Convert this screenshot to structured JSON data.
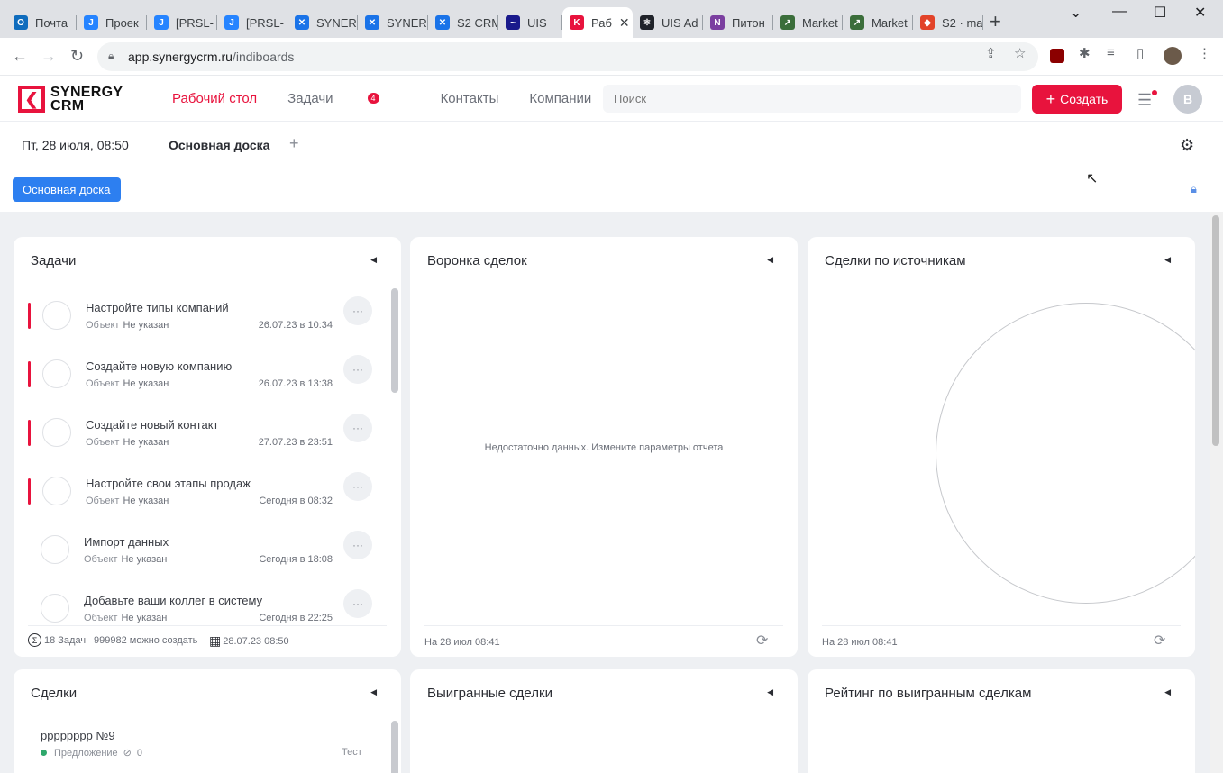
{
  "browser": {
    "tabs": [
      {
        "label": "Почта",
        "color": "#0f6cbd",
        "glyph": "O"
      },
      {
        "label": "Проек",
        "color": "#2684ff",
        "glyph": "J"
      },
      {
        "label": "[PRSL-",
        "color": "#2684ff",
        "glyph": "J"
      },
      {
        "label": "[PRSL-",
        "color": "#2684ff",
        "glyph": "J"
      },
      {
        "label": "SYNER",
        "color": "#1a73e8",
        "glyph": "✕"
      },
      {
        "label": "SYNER",
        "color": "#1a73e8",
        "glyph": "✕"
      },
      {
        "label": "S2 CRM",
        "color": "#1a73e8",
        "glyph": "✕"
      },
      {
        "label": "UIS",
        "color": "#1a1a8c",
        "glyph": "~"
      },
      {
        "label": "Раб",
        "color": "#e8133d",
        "glyph": "K"
      },
      {
        "label": "UIS Ad",
        "color": "#20232a",
        "glyph": "⚛"
      },
      {
        "label": "Питон",
        "color": "#7b3fa0",
        "glyph": "N"
      },
      {
        "label": "Market",
        "color": "#3b6e3b",
        "glyph": "↗"
      },
      {
        "label": "Market",
        "color": "#3b6e3b",
        "glyph": "↗"
      },
      {
        "label": "S2 · ma",
        "color": "#e24329",
        "glyph": "◆"
      }
    ],
    "url_host": "app.synergycrm.ru",
    "url_path": "/indiboards"
  },
  "app": {
    "logo_line1": "SYNERGY",
    "logo_line2": "CRM",
    "nav": {
      "desk": "Рабочий стол",
      "tasks": "Задачи",
      "tasks_badge": "4",
      "contacts": "Контакты",
      "companies": "Компании",
      "more": "···"
    },
    "search_placeholder": "Поиск",
    "create_label": "Создать",
    "avatar_initial": "B",
    "accent": "#e8133d"
  },
  "board": {
    "datetime": "Пт, 28 июля, 08:50",
    "tab": "Основная доска",
    "chip": "Основная доска"
  },
  "widgets": {
    "tasks": {
      "title": "Задачи",
      "items": [
        {
          "name": "Настройте типы компаний",
          "meta_label": "Объект",
          "meta_value": "Не указан",
          "due": "26.07.23 в 10:34",
          "overdue": true
        },
        {
          "name": "Создайте новую компанию",
          "meta_label": "Объект",
          "meta_value": "Не указан",
          "due": "26.07.23 в 13:38",
          "overdue": true
        },
        {
          "name": "Создайте новый контакт",
          "meta_label": "Объект",
          "meta_value": "Не указан",
          "due": "27.07.23 в 23:51",
          "overdue": true
        },
        {
          "name": "Настройте свои этапы продаж",
          "meta_label": "Объект",
          "meta_value": "Не указан",
          "due": "Сегодня в 08:32",
          "overdue": true
        },
        {
          "name": "Импорт данных",
          "meta_label": "Объект",
          "meta_value": "Не указан",
          "due": "Сегодня в 18:08",
          "overdue": false
        },
        {
          "name": "Добавьте ваши коллег в систему",
          "meta_label": "Объект",
          "meta_value": "Не указан",
          "due": "Сегодня в 22:25",
          "overdue": false
        }
      ],
      "footer_count": "18 Задач",
      "footer_available": "999982 можно создать",
      "footer_date": "28.07.23 08:50"
    },
    "funnel": {
      "title": "Воронка сделок",
      "empty": "Недостаточно данных. Измените параметры отчета",
      "updated": "На 28 июл 08:41"
    },
    "sources": {
      "title": "Сделки по источникам",
      "updated": "На 28 июл 08:41"
    },
    "deals": {
      "title": "Сделки",
      "item_name": "рррррррр №9",
      "item_stage": "Предложение",
      "item_count": "0",
      "item_owner": "Тест"
    },
    "won": {
      "title": "Выигранные сделки"
    },
    "rating": {
      "title": "Рейтинг по выигранным сделкам"
    }
  }
}
